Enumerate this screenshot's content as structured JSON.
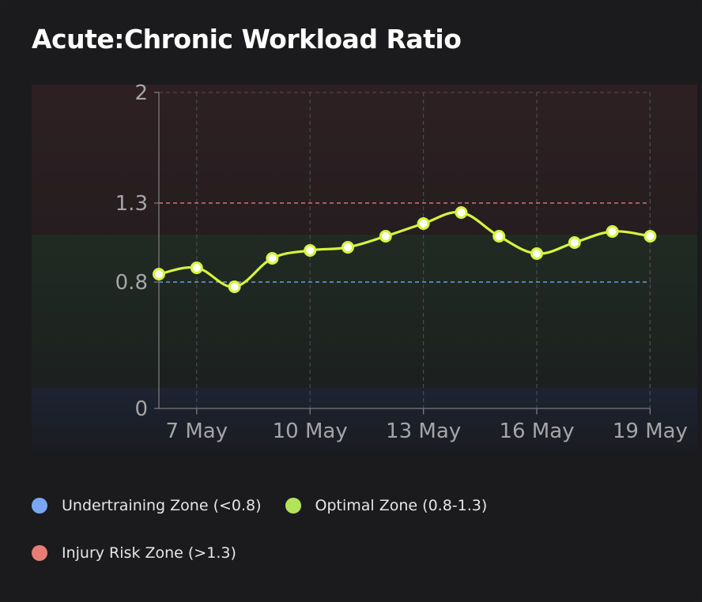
{
  "title": "Acute:Chronic Workload Ratio",
  "colors": {
    "line": "#d4f53c",
    "point_fill": "#ffffff",
    "undertraining": "#7aa7f5",
    "optimal": "#b3e35a",
    "injury": "#e97c76",
    "zone_injury_bg": "#2c1f21",
    "zone_optimal_bg": "#1f2a22",
    "zone_under_bg": "#1d2230"
  },
  "legend": [
    {
      "label": "Undertraining Zone (<0.8)",
      "color_key": "undertraining"
    },
    {
      "label": "Optimal Zone (0.8-1.3)",
      "color_key": "optimal"
    },
    {
      "label": "Injury Risk Zone (>1.3)",
      "color_key": "injury"
    }
  ],
  "chart_data": {
    "type": "line",
    "title": "Acute:Chronic Workload Ratio",
    "xlabel": "",
    "ylabel": "",
    "x": [
      "6 May",
      "7 May",
      "8 May",
      "9 May",
      "10 May",
      "11 May",
      "12 May",
      "13 May",
      "14 May",
      "15 May",
      "16 May",
      "17 May",
      "18 May",
      "19 May"
    ],
    "x_tick_labels": [
      "7 May",
      "10 May",
      "13 May",
      "16 May",
      "19 May"
    ],
    "series": [
      {
        "values": [
          0.85,
          0.89,
          0.77,
          0.95,
          1.0,
          1.02,
          1.09,
          1.17,
          1.24,
          1.09,
          0.98,
          1.05,
          1.12,
          1.09
        ]
      }
    ],
    "y_ticks": [
      0,
      0.8,
      1.3,
      2
    ],
    "y_tick_labels": [
      "0",
      "0.8",
      "1.3",
      "2"
    ],
    "ylim": [
      0,
      2
    ],
    "reference_lines": [
      {
        "value": 1.3,
        "color_key": "injury"
      },
      {
        "value": 0.8,
        "color_key": "undertraining"
      }
    ],
    "zones": [
      {
        "name": "injury",
        "from": 1.1,
        "to": 2.05
      },
      {
        "name": "optimal",
        "from": 0.13,
        "to": 1.1
      },
      {
        "name": "under",
        "from": -0.3,
        "to": 0.13
      }
    ],
    "grid": "dashed vertical and top horizontal",
    "legend_position": "bottom"
  }
}
